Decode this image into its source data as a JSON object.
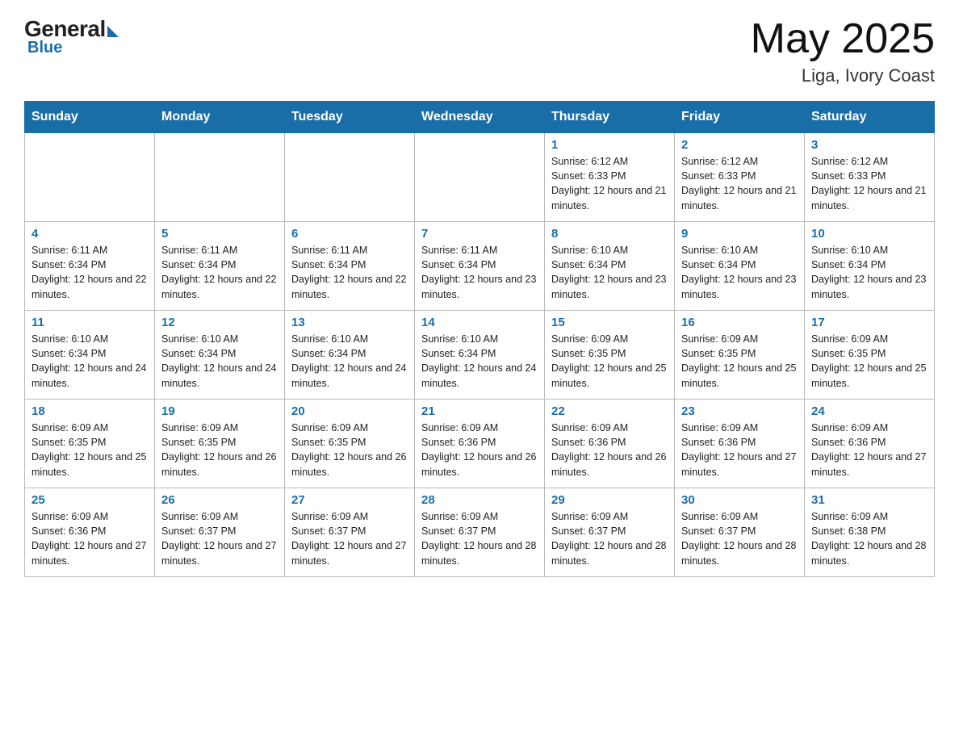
{
  "header": {
    "logo": {
      "general": "General",
      "blue": "Blue"
    },
    "title": "May 2025",
    "location": "Liga, Ivory Coast"
  },
  "calendar": {
    "days_of_week": [
      "Sunday",
      "Monday",
      "Tuesday",
      "Wednesday",
      "Thursday",
      "Friday",
      "Saturday"
    ],
    "weeks": [
      [
        {
          "day": "",
          "info": ""
        },
        {
          "day": "",
          "info": ""
        },
        {
          "day": "",
          "info": ""
        },
        {
          "day": "",
          "info": ""
        },
        {
          "day": "1",
          "info": "Sunrise: 6:12 AM\nSunset: 6:33 PM\nDaylight: 12 hours and 21 minutes."
        },
        {
          "day": "2",
          "info": "Sunrise: 6:12 AM\nSunset: 6:33 PM\nDaylight: 12 hours and 21 minutes."
        },
        {
          "day": "3",
          "info": "Sunrise: 6:12 AM\nSunset: 6:33 PM\nDaylight: 12 hours and 21 minutes."
        }
      ],
      [
        {
          "day": "4",
          "info": "Sunrise: 6:11 AM\nSunset: 6:34 PM\nDaylight: 12 hours and 22 minutes."
        },
        {
          "day": "5",
          "info": "Sunrise: 6:11 AM\nSunset: 6:34 PM\nDaylight: 12 hours and 22 minutes."
        },
        {
          "day": "6",
          "info": "Sunrise: 6:11 AM\nSunset: 6:34 PM\nDaylight: 12 hours and 22 minutes."
        },
        {
          "day": "7",
          "info": "Sunrise: 6:11 AM\nSunset: 6:34 PM\nDaylight: 12 hours and 23 minutes."
        },
        {
          "day": "8",
          "info": "Sunrise: 6:10 AM\nSunset: 6:34 PM\nDaylight: 12 hours and 23 minutes."
        },
        {
          "day": "9",
          "info": "Sunrise: 6:10 AM\nSunset: 6:34 PM\nDaylight: 12 hours and 23 minutes."
        },
        {
          "day": "10",
          "info": "Sunrise: 6:10 AM\nSunset: 6:34 PM\nDaylight: 12 hours and 23 minutes."
        }
      ],
      [
        {
          "day": "11",
          "info": "Sunrise: 6:10 AM\nSunset: 6:34 PM\nDaylight: 12 hours and 24 minutes."
        },
        {
          "day": "12",
          "info": "Sunrise: 6:10 AM\nSunset: 6:34 PM\nDaylight: 12 hours and 24 minutes."
        },
        {
          "day": "13",
          "info": "Sunrise: 6:10 AM\nSunset: 6:34 PM\nDaylight: 12 hours and 24 minutes."
        },
        {
          "day": "14",
          "info": "Sunrise: 6:10 AM\nSunset: 6:34 PM\nDaylight: 12 hours and 24 minutes."
        },
        {
          "day": "15",
          "info": "Sunrise: 6:09 AM\nSunset: 6:35 PM\nDaylight: 12 hours and 25 minutes."
        },
        {
          "day": "16",
          "info": "Sunrise: 6:09 AM\nSunset: 6:35 PM\nDaylight: 12 hours and 25 minutes."
        },
        {
          "day": "17",
          "info": "Sunrise: 6:09 AM\nSunset: 6:35 PM\nDaylight: 12 hours and 25 minutes."
        }
      ],
      [
        {
          "day": "18",
          "info": "Sunrise: 6:09 AM\nSunset: 6:35 PM\nDaylight: 12 hours and 25 minutes."
        },
        {
          "day": "19",
          "info": "Sunrise: 6:09 AM\nSunset: 6:35 PM\nDaylight: 12 hours and 26 minutes."
        },
        {
          "day": "20",
          "info": "Sunrise: 6:09 AM\nSunset: 6:35 PM\nDaylight: 12 hours and 26 minutes."
        },
        {
          "day": "21",
          "info": "Sunrise: 6:09 AM\nSunset: 6:36 PM\nDaylight: 12 hours and 26 minutes."
        },
        {
          "day": "22",
          "info": "Sunrise: 6:09 AM\nSunset: 6:36 PM\nDaylight: 12 hours and 26 minutes."
        },
        {
          "day": "23",
          "info": "Sunrise: 6:09 AM\nSunset: 6:36 PM\nDaylight: 12 hours and 27 minutes."
        },
        {
          "day": "24",
          "info": "Sunrise: 6:09 AM\nSunset: 6:36 PM\nDaylight: 12 hours and 27 minutes."
        }
      ],
      [
        {
          "day": "25",
          "info": "Sunrise: 6:09 AM\nSunset: 6:36 PM\nDaylight: 12 hours and 27 minutes."
        },
        {
          "day": "26",
          "info": "Sunrise: 6:09 AM\nSunset: 6:37 PM\nDaylight: 12 hours and 27 minutes."
        },
        {
          "day": "27",
          "info": "Sunrise: 6:09 AM\nSunset: 6:37 PM\nDaylight: 12 hours and 27 minutes."
        },
        {
          "day": "28",
          "info": "Sunrise: 6:09 AM\nSunset: 6:37 PM\nDaylight: 12 hours and 28 minutes."
        },
        {
          "day": "29",
          "info": "Sunrise: 6:09 AM\nSunset: 6:37 PM\nDaylight: 12 hours and 28 minutes."
        },
        {
          "day": "30",
          "info": "Sunrise: 6:09 AM\nSunset: 6:37 PM\nDaylight: 12 hours and 28 minutes."
        },
        {
          "day": "31",
          "info": "Sunrise: 6:09 AM\nSunset: 6:38 PM\nDaylight: 12 hours and 28 minutes."
        }
      ]
    ]
  }
}
